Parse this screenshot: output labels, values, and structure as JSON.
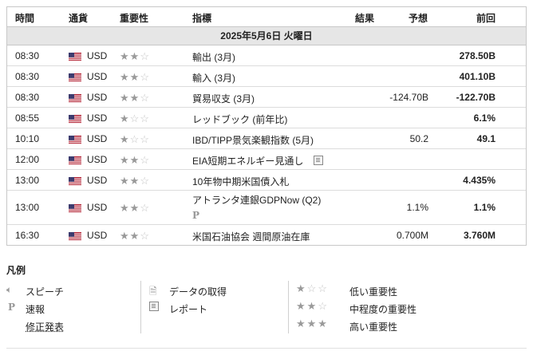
{
  "table": {
    "headers": {
      "time": "時間",
      "currency": "通貨",
      "importance": "重要性",
      "indicator": "指標",
      "result": "結果",
      "forecast": "予想",
      "previous": "前回"
    },
    "date": "2025年5月6日 火曜日",
    "rows": [
      {
        "time": "08:30",
        "currency": "USD",
        "stars": 2,
        "indicator": "輸出 (3月)",
        "result": "",
        "forecast": "",
        "previous": "278.50B"
      },
      {
        "time": "08:30",
        "currency": "USD",
        "stars": 2,
        "indicator": "輸入 (3月)",
        "result": "",
        "forecast": "",
        "previous": "401.10B"
      },
      {
        "time": "08:30",
        "currency": "USD",
        "stars": 2,
        "indicator": "貿易収支 (3月)",
        "result": "",
        "forecast": "-124.70B",
        "previous": "-122.70B"
      },
      {
        "time": "08:55",
        "currency": "USD",
        "stars": 1,
        "indicator": "レッドブック (前年比)",
        "result": "",
        "forecast": "",
        "previous": "6.1%"
      },
      {
        "time": "10:10",
        "currency": "USD",
        "stars": 1,
        "indicator": "IBD/TIPP景気楽観指数 (5月)",
        "result": "",
        "forecast": "50.2",
        "previous": "49.1"
      },
      {
        "time": "12:00",
        "currency": "USD",
        "stars": 2,
        "indicator": "EIA短期エネルギー見通し",
        "result": "",
        "forecast": "",
        "previous": "",
        "icon": "report-icon"
      },
      {
        "time": "13:00",
        "currency": "USD",
        "stars": 2,
        "indicator": "10年物中期米国債入札",
        "result": "",
        "forecast": "",
        "previous": "4.435%"
      },
      {
        "time": "13:00",
        "currency": "USD",
        "stars": 2,
        "indicator": "アトランタ連銀GDPNow (Q2)",
        "result": "",
        "forecast": "1.1%",
        "previous": "1.1%",
        "icon": "preliminary-icon",
        "icon_text": "P"
      },
      {
        "time": "16:30",
        "currency": "USD",
        "stars": 2,
        "indicator": "米国石油協会 週間原油在庫",
        "result": "",
        "forecast": "0.700M",
        "previous": "3.760M"
      }
    ]
  },
  "legend": {
    "title": "凡例",
    "speech": "スピーチ",
    "preliminary": "速報",
    "preliminary_icon_text": "P",
    "revised": "修正発表",
    "data_fetch": "データの取得",
    "report": "レポート",
    "low": "低い重要性",
    "medium": "中程度の重要性",
    "high": "高い重要性"
  },
  "colors": {
    "header_bg": "#e6e6e6",
    "border": "#c8c8c8",
    "star_on": "#9a9a9a",
    "star_off": "#c4c4c4"
  }
}
